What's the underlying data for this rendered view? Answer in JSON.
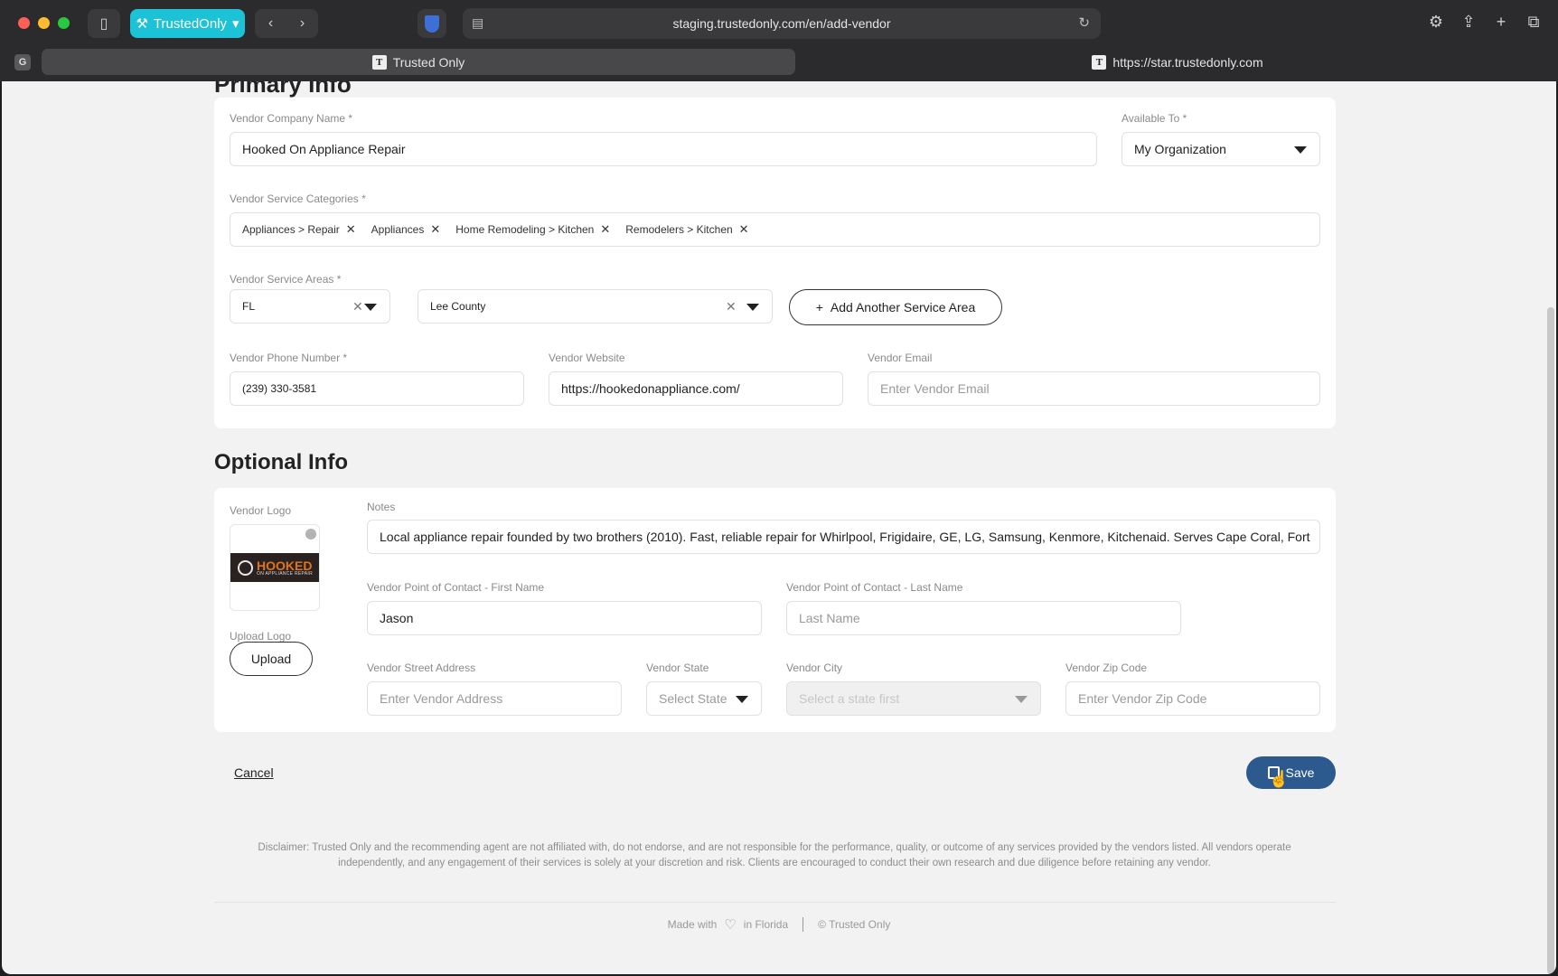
{
  "browser": {
    "profile_label": "TrustedOnly",
    "url": "staging.trustedonly.com/en/add-vendor",
    "tabs": [
      {
        "label": "Trusted Only",
        "favicon": "T"
      },
      {
        "label": "https://star.trustedonly.com",
        "favicon": "T"
      }
    ],
    "tab_group_badge": "G"
  },
  "primary": {
    "heading_partial": "Primary Info",
    "company_name": {
      "label": "Vendor Company Name *",
      "value": "Hooked On Appliance Repair"
    },
    "available_to": {
      "label": "Available To *",
      "value": "My Organization"
    },
    "categories": {
      "label": "Vendor Service Categories *",
      "chips": [
        "Appliances > Repair",
        "Appliances",
        "Home Remodeling > Kitchen",
        "Remodelers > Kitchen"
      ]
    },
    "service_areas": {
      "label": "Vendor Service Areas *",
      "state": "FL",
      "county": "Lee County",
      "add_label": "Add Another Service Area"
    },
    "phone": {
      "label": "Vendor Phone Number  *",
      "value": "(239) 330-3581"
    },
    "website": {
      "label": "Vendor Website",
      "value": "https://hookedonappliance.com/"
    },
    "email": {
      "label": "Vendor Email",
      "placeholder": "Enter Vendor Email"
    }
  },
  "optional": {
    "title": "Optional Info",
    "logo": {
      "label": "Vendor Logo",
      "brand_word": "HOOKED",
      "brand_sub": "ON APPLIANCE REPAIR"
    },
    "upload": {
      "label": "Upload Logo",
      "button": "Upload"
    },
    "notes": {
      "label": "Notes",
      "value": "Local appliance repair founded by two brothers (2010). Fast, reliable repair for Whirlpool, Frigidaire, GE, LG, Samsung, Kenmore, Kitchenaid. Serves Cape Coral, Fort"
    },
    "first_name": {
      "label": "Vendor Point of Contact - First Name",
      "value": "Jason"
    },
    "last_name": {
      "label": "Vendor Point of Contact - Last Name",
      "placeholder": "Last Name"
    },
    "street": {
      "label": "Vendor Street Address",
      "placeholder": "Enter Vendor Address"
    },
    "state": {
      "label": "Vendor State",
      "placeholder": "Select State"
    },
    "city": {
      "label": "Vendor City",
      "placeholder": "Select a state first"
    },
    "zip": {
      "label": "Vendor Zip Code",
      "placeholder": "Enter Vendor Zip Code"
    }
  },
  "actions": {
    "cancel": "Cancel",
    "save": "Save"
  },
  "disclaimer": "Disclaimer: Trusted Only and the recommending agent are not affiliated with, do not endorse, and are not responsible for the performance, quality, or outcome of any services provided by the vendors listed. All vendors operate independently, and any engagement of their services is solely at your discretion and risk. Clients are encouraged to conduct their own research and due diligence before retaining any vendor.",
  "footer": {
    "made_with": "Made with",
    "in_florida": "in Florida",
    "copyright": "© Trusted Only"
  },
  "colors": {
    "accent": "#1cc3d6",
    "save": "#2c5a8f",
    "logo_orange": "#e2731e"
  }
}
